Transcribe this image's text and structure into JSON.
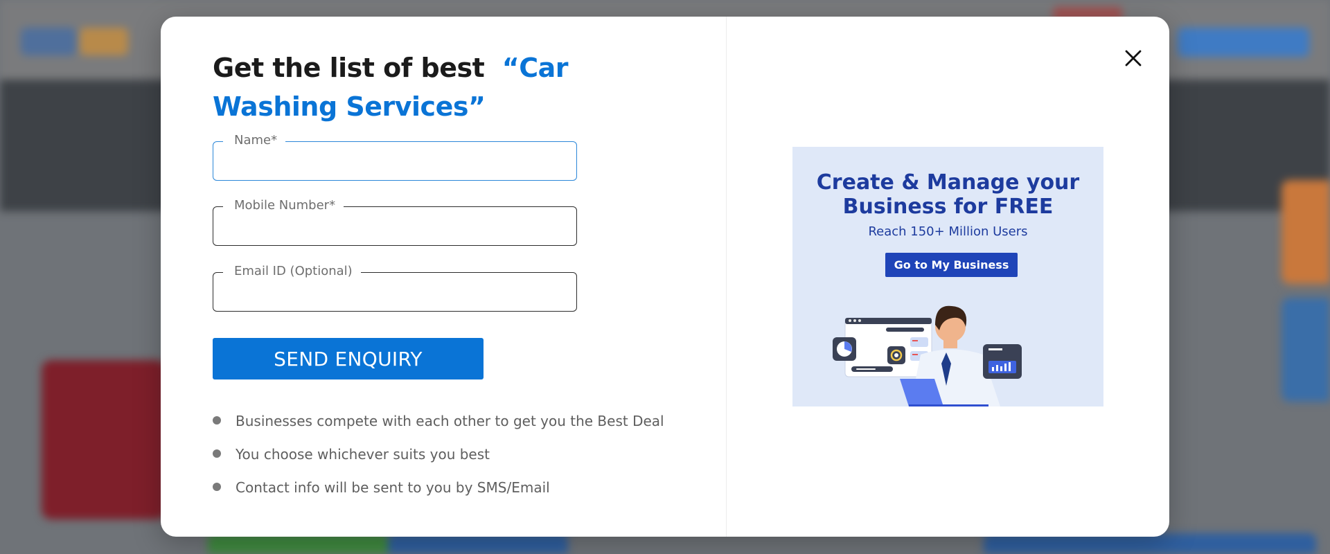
{
  "modal": {
    "title_prefix": "Get the list of best",
    "title_highlight": "“Car Washing Services”",
    "fields": [
      {
        "label": "Name*",
        "value": "",
        "placeholder": ""
      },
      {
        "label": "Mobile Number*",
        "value": "",
        "placeholder": ""
      },
      {
        "label": "Email ID (Optional)",
        "value": "",
        "placeholder": ""
      }
    ],
    "send_button": "SEND ENQUIRY",
    "benefits": [
      "Businesses compete with each other to get you the Best Deal",
      "You choose whichever suits you best",
      "Contact info will be sent to you by SMS/Email"
    ],
    "close_icon": "close-icon"
  },
  "ad": {
    "title_line1": "Create & Manage your",
    "title_line2": "Business for FREE",
    "subtitle": "Reach 150+ Million Users",
    "button": "Go to My Business"
  },
  "colors": {
    "accent": "#0a74d6",
    "ad_text": "#1d3b9e",
    "ad_background": "#dfe8f8"
  }
}
